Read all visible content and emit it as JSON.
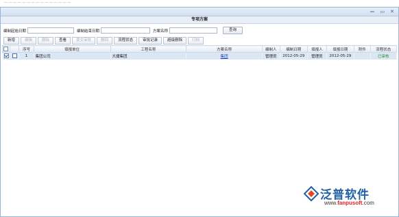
{
  "topbar": {
    "crumbs": "— — — — — — — — — — — — — — —"
  },
  "window": {
    "title": "专项方案",
    "controls": [
      "—",
      "▭",
      "✕"
    ]
  },
  "filters": {
    "start_label": "编制起始日期",
    "end_label": "编制结束日期",
    "name_label": "方案名称",
    "query_label": "查询"
  },
  "toolbar": [
    "新增",
    "编辑",
    "删除",
    "查看",
    "提交审批",
    "删回",
    "流程状态",
    "审批记录",
    "超级删除",
    "归档"
  ],
  "toolbar_disabled": [
    false,
    true,
    true,
    false,
    true,
    true,
    false,
    false,
    false,
    true
  ],
  "table": {
    "headers": [
      "",
      "",
      "序号",
      "填报单位",
      "工程名称",
      "方案名称",
      "编制人",
      "编制日期",
      "填报人",
      "填报日期",
      "附件",
      "流程状态"
    ],
    "rows": [
      {
        "checked": true,
        "num": "1",
        "unit": "集团公司",
        "project": "大捷集团",
        "scheme": "集团",
        "editor": "管理员",
        "edit_date": "2012-05-29",
        "reporter": "管理员",
        "report_date": "2012-05-29",
        "attachment": "",
        "status": "已审核"
      }
    ]
  },
  "logo": {
    "brand": "泛普软件",
    "url_prefix": "www.",
    "url_main": "fanpusoft",
    "url_suffix": ".com"
  },
  "colors": {
    "accent": "#1f5fa5",
    "status_ok": "#1b8f2c"
  }
}
